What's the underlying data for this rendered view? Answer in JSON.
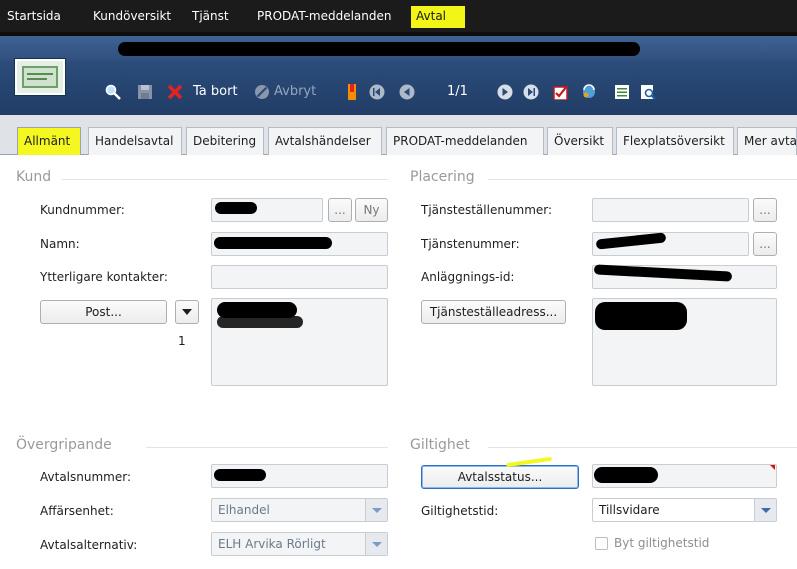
{
  "topmenu": {
    "items": [
      "Startsida",
      "Kundöversikt",
      "Tjänst",
      "PRODAT-meddelanden",
      "Avtal"
    ],
    "active": "Avtal"
  },
  "toolbar": {
    "delete_label": "Ta bort",
    "cancel_label": "Avbryt",
    "record_counter": "1/1",
    "icons": [
      "search-icon",
      "save-icon",
      "delete-icon",
      "cancel-icon",
      "bookmark-icon",
      "first-record-icon",
      "prev-record-icon",
      "next-record-icon",
      "last-record-icon",
      "checklist-icon",
      "refresh-icon",
      "list-icon",
      "preview-icon"
    ]
  },
  "tabs": [
    "Allmänt",
    "Handelsavtal",
    "Debitering",
    "Avtalshändelser",
    "PRODAT-meddelanden",
    "Översikt",
    "Flexplatsöversikt",
    "Mer avta"
  ],
  "kund": {
    "heading": "Kund",
    "kundnummer_label": "Kundnummer:",
    "browse_label": "...",
    "new_label": "Ny",
    "namn_label": "Namn:",
    "kontakter_label": "Ytterligare kontakter:",
    "post_button": "Post...",
    "post_count": "1"
  },
  "placering": {
    "heading": "Placering",
    "tjanstestalle_label": "Tjänsteställenummer:",
    "tjanstenummer_label": "Tjänstenummer:",
    "anlaggning_label": "Anläggnings-id:",
    "browse_label": "...",
    "address_button": "Tjänsteställeadress..."
  },
  "overgripande": {
    "heading": "Övergripande",
    "avtalsnummer_label": "Avtalsnummer:",
    "affarsenhet_label": "Affärsenhet:",
    "affarsenhet_value": "Elhandel",
    "avtalsalternativ_label": "Avtalsalternativ:",
    "avtalsalternativ_value": "ELH Arvika Rörligt"
  },
  "giltighet": {
    "heading": "Giltighet",
    "status_button": "Avtalsstatus...",
    "giltighetstid_label": "Giltighetstid:",
    "giltighetstid_value": "Tillsvidare",
    "byt_label": "Byt giltighetstid"
  },
  "colors": {
    "highlight": "#f4f820",
    "menu_bg": "#1b1b1b",
    "toolbar_bg": "#2a4a78",
    "accent_blue": "#3d6ba8"
  }
}
